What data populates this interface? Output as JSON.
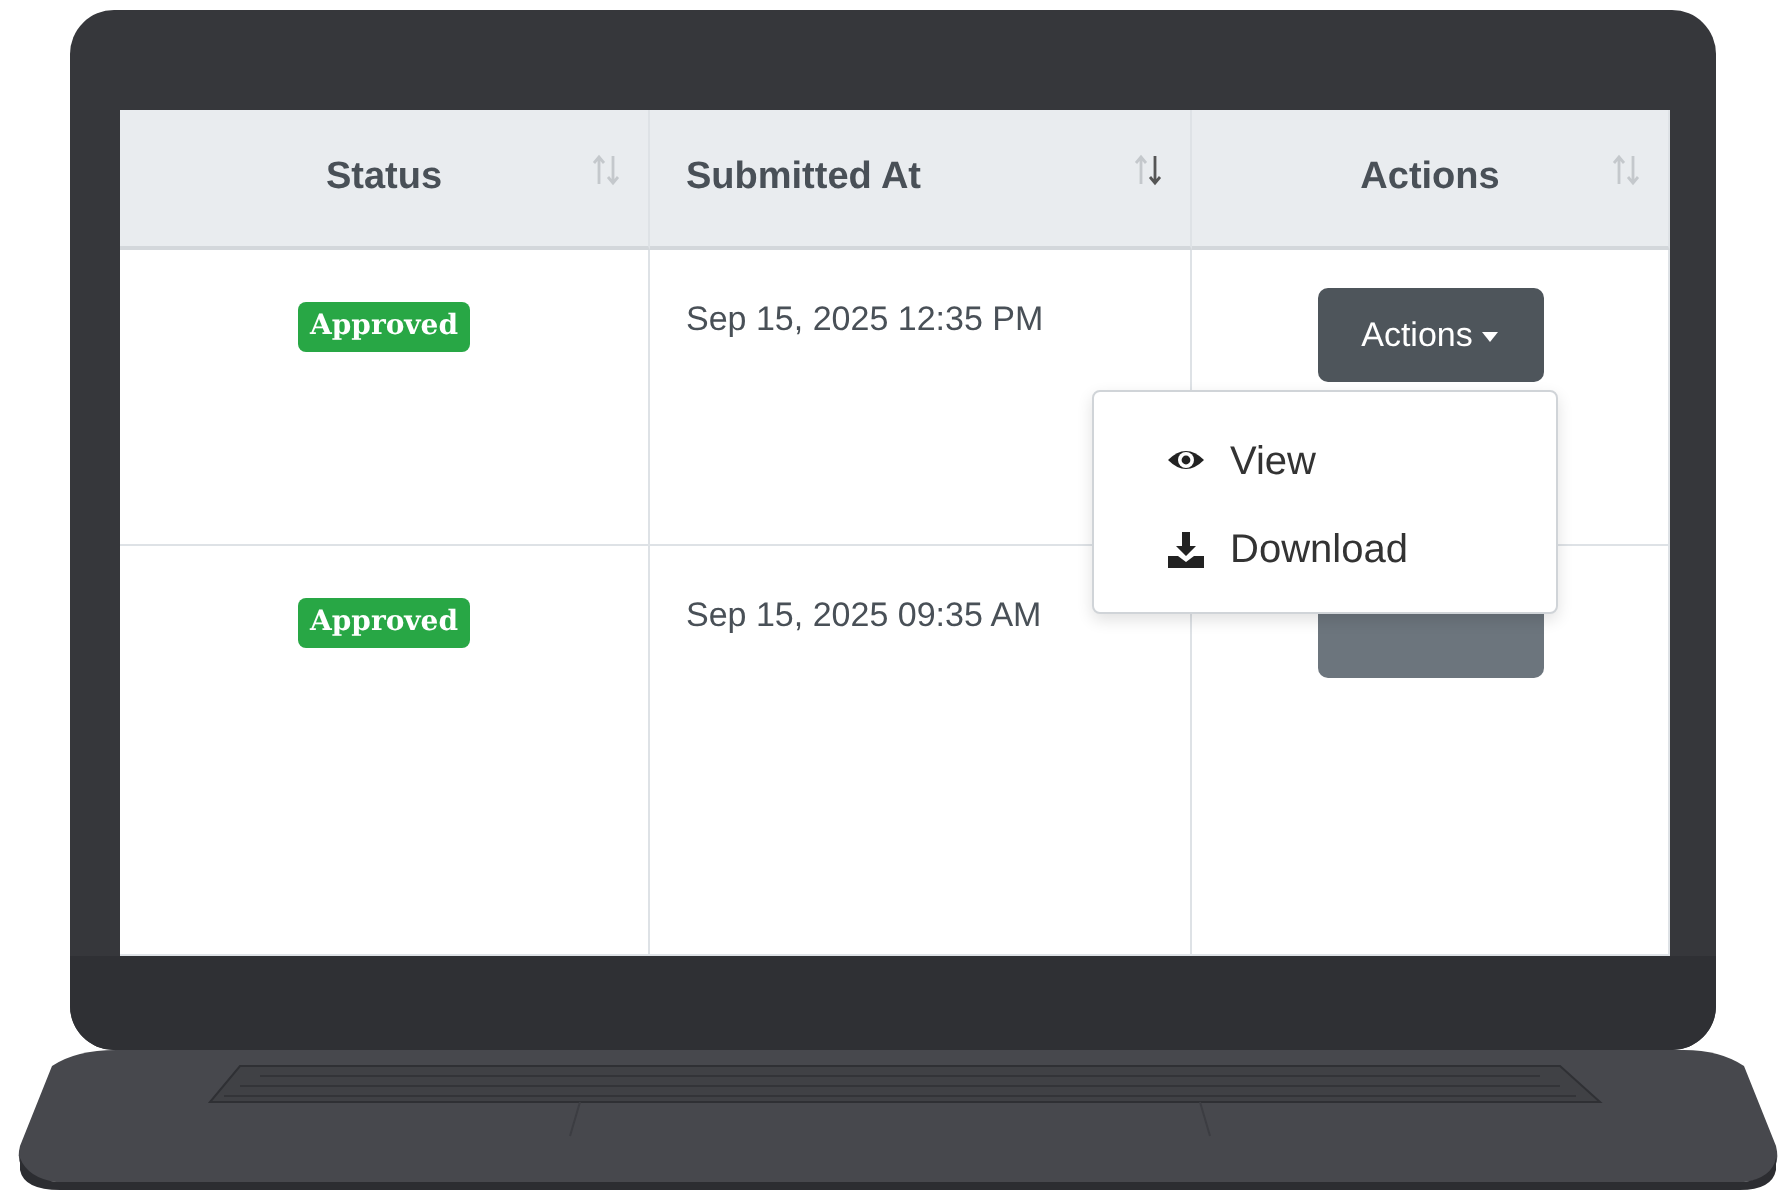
{
  "table": {
    "columns": [
      {
        "label": "Status",
        "sorted_desc": false
      },
      {
        "label": "Submitted At",
        "sorted_desc": true
      },
      {
        "label": "Actions",
        "sorted_desc": false
      }
    ],
    "rows": [
      {
        "status": "Approved",
        "submitted_at": "Sep 15, 2025 12:35 PM",
        "action_button": {
          "label": "Actions",
          "active": true
        },
        "menu": {
          "items": [
            {
              "kind": "view",
              "label": "View"
            },
            {
              "kind": "download",
              "label": "Download"
            }
          ]
        }
      },
      {
        "status": "Approved",
        "submitted_at": "Sep 15, 2025 09:35 AM",
        "action_button": {
          "active": false
        }
      }
    ]
  }
}
